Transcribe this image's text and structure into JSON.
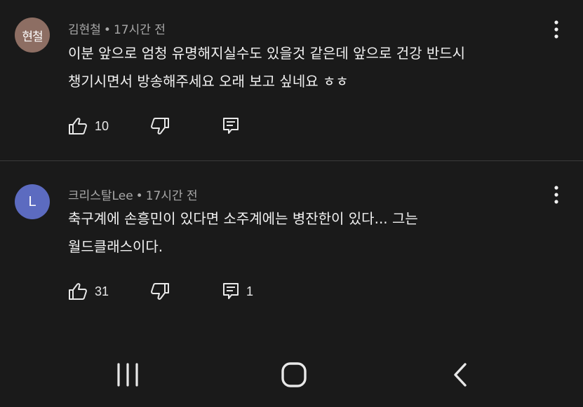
{
  "colors": {
    "background": "#1a1a1a",
    "avatar_1": "#8d6e63",
    "avatar_2": "#5c6bc0",
    "meta_text": "#a8a8a8",
    "body_text": "#f1f1f1"
  },
  "comments": [
    {
      "avatar_text": "현철",
      "author": "김현철",
      "time": "17시간 전",
      "lines": [
        "이분 앞으로 엄청 유명해지실수도 있을것 같은데 앞으로 건강 반드시",
        "챙기시면서 방송해주세요 오래 보고 싶네요 ㅎㅎ"
      ],
      "likes": "10",
      "replies": ""
    },
    {
      "avatar_text": "L",
      "author": "크리스탈Lee",
      "time": "17시간 전",
      "lines": [
        "축구계에 손흥민이 있다면 소주계에는 병잔한이 있다... 그는",
        "월드클래스이다."
      ],
      "likes": "31",
      "replies": "1"
    }
  ],
  "meta_separator": "•",
  "icons": {
    "more": "more-vert-icon",
    "like": "thumb-up-icon",
    "dislike": "thumb-down-icon",
    "reply": "comment-icon",
    "nav_recent": "recent-apps-icon",
    "nav_home": "home-icon",
    "nav_back": "back-icon"
  }
}
